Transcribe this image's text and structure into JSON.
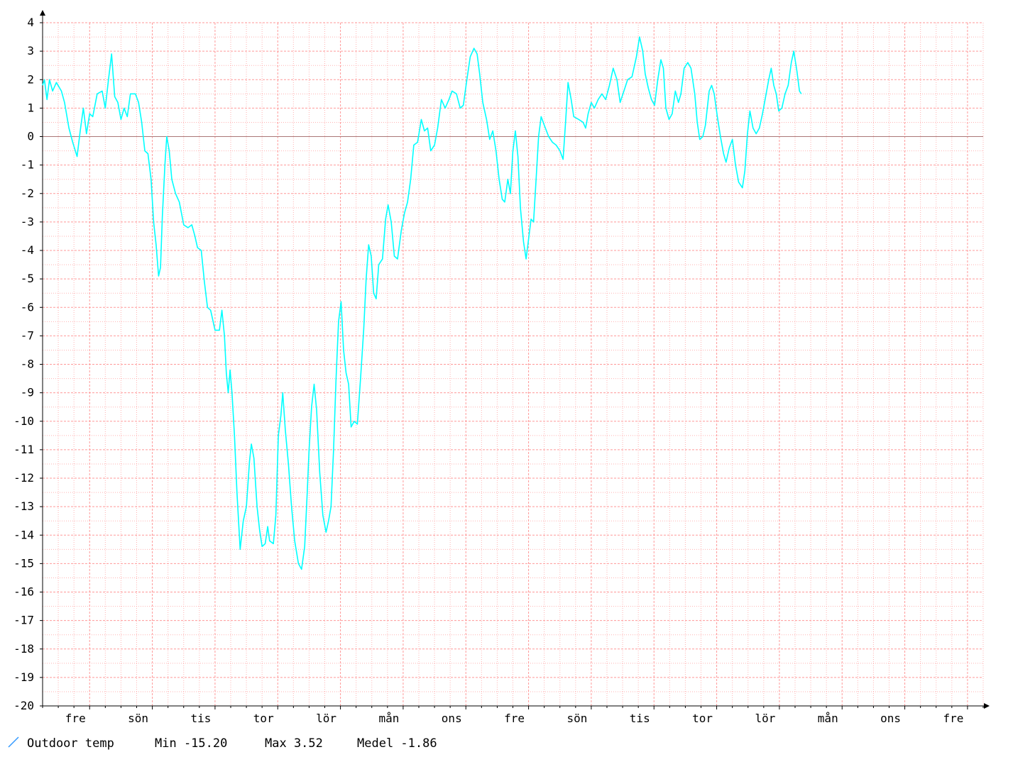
{
  "chart_data": {
    "type": "line",
    "title": "",
    "xlabel": "",
    "ylabel": "",
    "ylim": [
      -20,
      4
    ],
    "y_ticks": [
      4,
      3,
      2,
      1,
      0,
      -1,
      -2,
      -3,
      -4,
      -5,
      -6,
      -7,
      -8,
      -9,
      -10,
      -11,
      -12,
      -13,
      -14,
      -15,
      -16,
      -17,
      -18,
      -19,
      -20
    ],
    "x_domain": [
      0,
      15
    ],
    "x_ticks": [
      {
        "x": 0.75,
        "label": "fre"
      },
      {
        "x": 1.75,
        "label": "sön"
      },
      {
        "x": 2.75,
        "label": "tis"
      },
      {
        "x": 3.75,
        "label": "tor"
      },
      {
        "x": 4.75,
        "label": "lör"
      },
      {
        "x": 5.75,
        "label": "mån"
      },
      {
        "x": 6.75,
        "label": "ons"
      },
      {
        "x": 7.75,
        "label": "fre"
      },
      {
        "x": 8.75,
        "label": "sön"
      },
      {
        "x": 9.75,
        "label": "tis"
      },
      {
        "x": 10.75,
        "label": "tor"
      },
      {
        "x": 11.75,
        "label": "lör"
      },
      {
        "x": 12.75,
        "label": "mån"
      },
      {
        "x": 13.75,
        "label": "ons"
      },
      {
        "x": 14.75,
        "label": "fre"
      }
    ],
    "grid": true,
    "zero_line": true,
    "colors": {
      "series": "#00ffff",
      "grid": "#ff9999",
      "zero_line": "#aa7777",
      "axis": "#000000",
      "legend_swatch": "#3399ff"
    },
    "legend": {
      "placement": "bottom-left",
      "series_label": "Outdoor temp",
      "min_text": "Min -15.20",
      "max_text": "Max 3.52",
      "mean_text": "Medel -1.86"
    },
    "series": [
      {
        "name": "Outdoor temp",
        "points": [
          [
            0.0,
            1.8
          ],
          [
            0.03,
            2.0
          ],
          [
            0.07,
            1.3
          ],
          [
            0.11,
            2.0
          ],
          [
            0.16,
            1.6
          ],
          [
            0.22,
            1.9
          ],
          [
            0.3,
            1.6
          ],
          [
            0.35,
            1.2
          ],
          [
            0.42,
            0.3
          ],
          [
            0.48,
            -0.2
          ],
          [
            0.55,
            -0.7
          ],
          [
            0.6,
            0.2
          ],
          [
            0.65,
            1.0
          ],
          [
            0.7,
            0.1
          ],
          [
            0.75,
            0.8
          ],
          [
            0.8,
            0.7
          ],
          [
            0.87,
            1.5
          ],
          [
            0.95,
            1.6
          ],
          [
            1.0,
            1.0
          ],
          [
            1.05,
            2.0
          ],
          [
            1.1,
            2.9
          ],
          [
            1.15,
            1.4
          ],
          [
            1.2,
            1.2
          ],
          [
            1.25,
            0.6
          ],
          [
            1.3,
            1.0
          ],
          [
            1.35,
            0.7
          ],
          [
            1.4,
            1.5
          ],
          [
            1.48,
            1.5
          ],
          [
            1.53,
            1.2
          ],
          [
            1.58,
            0.5
          ],
          [
            1.63,
            -0.5
          ],
          [
            1.68,
            -0.6
          ],
          [
            1.73,
            -1.5
          ],
          [
            1.77,
            -3.0
          ],
          [
            1.81,
            -3.8
          ],
          [
            1.85,
            -4.9
          ],
          [
            1.88,
            -4.6
          ],
          [
            1.91,
            -2.8
          ],
          [
            1.95,
            -1.0
          ],
          [
            1.98,
            0.0
          ],
          [
            2.02,
            -0.5
          ],
          [
            2.06,
            -1.5
          ],
          [
            2.12,
            -2.0
          ],
          [
            2.18,
            -2.3
          ],
          [
            2.25,
            -3.1
          ],
          [
            2.32,
            -3.2
          ],
          [
            2.38,
            -3.1
          ],
          [
            2.43,
            -3.5
          ],
          [
            2.47,
            -3.9
          ],
          [
            2.53,
            -4.0
          ],
          [
            2.58,
            -5.1
          ],
          [
            2.63,
            -6.0
          ],
          [
            2.68,
            -6.1
          ],
          [
            2.75,
            -6.8
          ],
          [
            2.82,
            -6.8
          ],
          [
            2.86,
            -6.1
          ],
          [
            2.9,
            -7.0
          ],
          [
            2.93,
            -8.3
          ],
          [
            2.96,
            -9.0
          ],
          [
            2.99,
            -8.2
          ],
          [
            3.02,
            -9.0
          ],
          [
            3.06,
            -10.5
          ],
          [
            3.1,
            -12.5
          ],
          [
            3.15,
            -14.5
          ],
          [
            3.2,
            -13.5
          ],
          [
            3.25,
            -13.0
          ],
          [
            3.3,
            -11.4
          ],
          [
            3.33,
            -10.8
          ],
          [
            3.37,
            -11.3
          ],
          [
            3.42,
            -13.0
          ],
          [
            3.46,
            -13.8
          ],
          [
            3.5,
            -14.4
          ],
          [
            3.55,
            -14.3
          ],
          [
            3.59,
            -13.7
          ],
          [
            3.62,
            -14.2
          ],
          [
            3.68,
            -14.3
          ],
          [
            3.72,
            -13.3
          ],
          [
            3.76,
            -10.5
          ],
          [
            3.8,
            -9.8
          ],
          [
            3.83,
            -9.0
          ],
          [
            3.87,
            -10.3
          ],
          [
            3.92,
            -11.5
          ],
          [
            3.97,
            -13.0
          ],
          [
            4.02,
            -14.2
          ],
          [
            4.08,
            -15.0
          ],
          [
            4.13,
            -15.2
          ],
          [
            4.18,
            -14.4
          ],
          [
            4.22,
            -12.5
          ],
          [
            4.25,
            -11.0
          ],
          [
            4.29,
            -9.5
          ],
          [
            4.33,
            -8.7
          ],
          [
            4.37,
            -9.6
          ],
          [
            4.42,
            -11.8
          ],
          [
            4.47,
            -13.3
          ],
          [
            4.52,
            -13.9
          ],
          [
            4.56,
            -13.5
          ],
          [
            4.6,
            -13.0
          ],
          [
            4.64,
            -11.0
          ],
          [
            4.68,
            -8.5
          ],
          [
            4.72,
            -6.5
          ],
          [
            4.76,
            -5.8
          ],
          [
            4.8,
            -7.5
          ],
          [
            4.84,
            -8.3
          ],
          [
            4.88,
            -8.7
          ],
          [
            4.92,
            -10.2
          ],
          [
            4.97,
            -10.0
          ],
          [
            5.02,
            -10.1
          ],
          [
            5.07,
            -8.5
          ],
          [
            5.12,
            -6.8
          ],
          [
            5.16,
            -5.0
          ],
          [
            5.2,
            -3.8
          ],
          [
            5.24,
            -4.2
          ],
          [
            5.28,
            -5.5
          ],
          [
            5.32,
            -5.7
          ],
          [
            5.36,
            -4.5
          ],
          [
            5.42,
            -4.3
          ],
          [
            5.47,
            -2.9
          ],
          [
            5.51,
            -2.4
          ],
          [
            5.56,
            -3.0
          ],
          [
            5.61,
            -4.2
          ],
          [
            5.66,
            -4.3
          ],
          [
            5.72,
            -3.3
          ],
          [
            5.77,
            -2.7
          ],
          [
            5.82,
            -2.3
          ],
          [
            5.87,
            -1.5
          ],
          [
            5.92,
            -0.3
          ],
          [
            5.98,
            -0.2
          ],
          [
            6.04,
            0.6
          ],
          [
            6.09,
            0.2
          ],
          [
            6.14,
            0.3
          ],
          [
            6.19,
            -0.5
          ],
          [
            6.25,
            -0.3
          ],
          [
            6.3,
            0.3
          ],
          [
            6.36,
            1.3
          ],
          [
            6.42,
            1.0
          ],
          [
            6.48,
            1.3
          ],
          [
            6.53,
            1.6
          ],
          [
            6.6,
            1.5
          ],
          [
            6.66,
            1.0
          ],
          [
            6.71,
            1.1
          ],
          [
            6.76,
            1.9
          ],
          [
            6.82,
            2.8
          ],
          [
            6.88,
            3.1
          ],
          [
            6.93,
            2.9
          ],
          [
            6.97,
            2.2
          ],
          [
            7.02,
            1.2
          ],
          [
            7.08,
            0.6
          ],
          [
            7.13,
            -0.1
          ],
          [
            7.18,
            0.2
          ],
          [
            7.23,
            -0.5
          ],
          [
            7.28,
            -1.5
          ],
          [
            7.33,
            -2.2
          ],
          [
            7.37,
            -2.3
          ],
          [
            7.42,
            -1.5
          ],
          [
            7.46,
            -2.0
          ],
          [
            7.5,
            -0.5
          ],
          [
            7.54,
            0.2
          ],
          [
            7.58,
            -0.7
          ],
          [
            7.62,
            -2.5
          ],
          [
            7.67,
            -3.7
          ],
          [
            7.71,
            -4.3
          ],
          [
            7.75,
            -3.6
          ],
          [
            7.79,
            -2.9
          ],
          [
            7.83,
            -3.0
          ],
          [
            7.87,
            -1.5
          ],
          [
            7.91,
            0.0
          ],
          [
            7.95,
            0.7
          ],
          [
            8.0,
            0.4
          ],
          [
            8.07,
            0.0
          ],
          [
            8.13,
            -0.2
          ],
          [
            8.19,
            -0.3
          ],
          [
            8.25,
            -0.5
          ],
          [
            8.3,
            -0.8
          ],
          [
            8.34,
            0.5
          ],
          [
            8.38,
            1.9
          ],
          [
            8.43,
            1.3
          ],
          [
            8.47,
            0.7
          ],
          [
            8.55,
            0.6
          ],
          [
            8.62,
            0.5
          ],
          [
            8.66,
            0.3
          ],
          [
            8.7,
            0.8
          ],
          [
            8.75,
            1.2
          ],
          [
            8.8,
            1.0
          ],
          [
            8.86,
            1.3
          ],
          [
            8.92,
            1.5
          ],
          [
            8.98,
            1.3
          ],
          [
            9.04,
            1.8
          ],
          [
            9.1,
            2.4
          ],
          [
            9.16,
            2.0
          ],
          [
            9.21,
            1.2
          ],
          [
            9.27,
            1.6
          ],
          [
            9.33,
            2.0
          ],
          [
            9.4,
            2.1
          ],
          [
            9.47,
            2.8
          ],
          [
            9.52,
            3.5
          ],
          [
            9.57,
            3.0
          ],
          [
            9.61,
            2.2
          ],
          [
            9.66,
            1.7
          ],
          [
            9.71,
            1.3
          ],
          [
            9.76,
            1.1
          ],
          [
            9.81,
            2.0
          ],
          [
            9.86,
            2.7
          ],
          [
            9.9,
            2.4
          ],
          [
            9.94,
            1.0
          ],
          [
            9.99,
            0.6
          ],
          [
            10.04,
            0.8
          ],
          [
            10.09,
            1.6
          ],
          [
            10.14,
            1.2
          ],
          [
            10.18,
            1.5
          ],
          [
            10.23,
            2.4
          ],
          [
            10.29,
            2.6
          ],
          [
            10.34,
            2.4
          ],
          [
            10.4,
            1.5
          ],
          [
            10.44,
            0.5
          ],
          [
            10.48,
            -0.1
          ],
          [
            10.53,
            0.0
          ],
          [
            10.57,
            0.4
          ],
          [
            10.63,
            1.6
          ],
          [
            10.67,
            1.8
          ],
          [
            10.71,
            1.5
          ],
          [
            10.76,
            0.7
          ],
          [
            10.81,
            0.0
          ],
          [
            10.86,
            -0.6
          ],
          [
            10.9,
            -0.9
          ],
          [
            10.95,
            -0.4
          ],
          [
            11.0,
            -0.1
          ],
          [
            11.05,
            -1.0
          ],
          [
            11.1,
            -1.6
          ],
          [
            11.16,
            -1.8
          ],
          [
            11.2,
            -1.2
          ],
          [
            11.24,
            0.1
          ],
          [
            11.28,
            0.9
          ],
          [
            11.33,
            0.3
          ],
          [
            11.38,
            0.1
          ],
          [
            11.43,
            0.3
          ],
          [
            11.48,
            0.8
          ],
          [
            11.53,
            1.4
          ],
          [
            11.58,
            2.0
          ],
          [
            11.62,
            2.4
          ],
          [
            11.66,
            1.8
          ],
          [
            11.7,
            1.5
          ],
          [
            11.74,
            0.9
          ],
          [
            11.79,
            1.0
          ],
          [
            11.84,
            1.5
          ],
          [
            11.89,
            1.8
          ],
          [
            11.94,
            2.6
          ],
          [
            11.98,
            3.0
          ],
          [
            12.03,
            2.3
          ],
          [
            12.07,
            1.6
          ],
          [
            12.1,
            1.5
          ]
        ]
      }
    ]
  }
}
